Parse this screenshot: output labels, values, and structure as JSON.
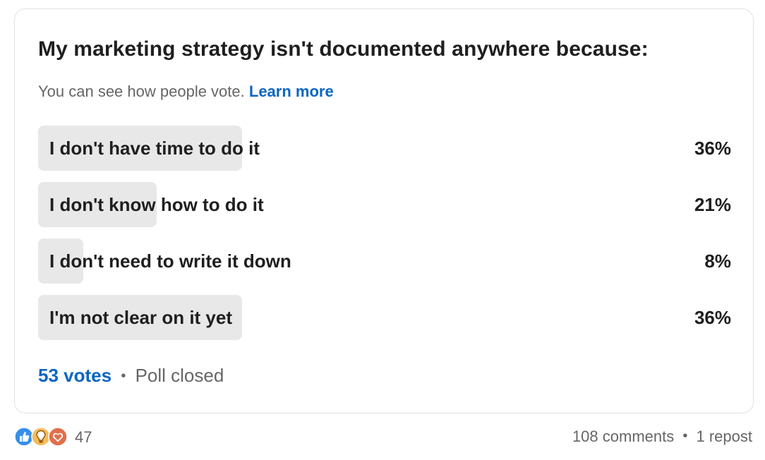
{
  "poll": {
    "question": "My marketing strategy isn't documented anywhere because:",
    "visibility_note": "You can see how people vote.",
    "learn_more": "Learn more",
    "options": [
      {
        "label": "I don't have time to do it",
        "percent_text": "36%",
        "percent": 36
      },
      {
        "label": "I don't know how to do it",
        "percent_text": "21%",
        "percent": 21
      },
      {
        "label": "I don't need to write it down",
        "percent_text": "8%",
        "percent": 8
      },
      {
        "label": "I'm not clear on it yet",
        "percent_text": "36%",
        "percent": 36
      }
    ],
    "votes": "53 votes",
    "separator": "•",
    "status": "Poll closed"
  },
  "social": {
    "reaction_icons": [
      "like-icon",
      "insightful-icon",
      "love-icon"
    ],
    "reaction_count": "47",
    "comments": "108 comments",
    "separator": "•",
    "reposts": "1 repost"
  },
  "colors": {
    "accent": "#0a66c2",
    "bar_fill": "#e8e8e8",
    "muted_text": "#666666"
  }
}
